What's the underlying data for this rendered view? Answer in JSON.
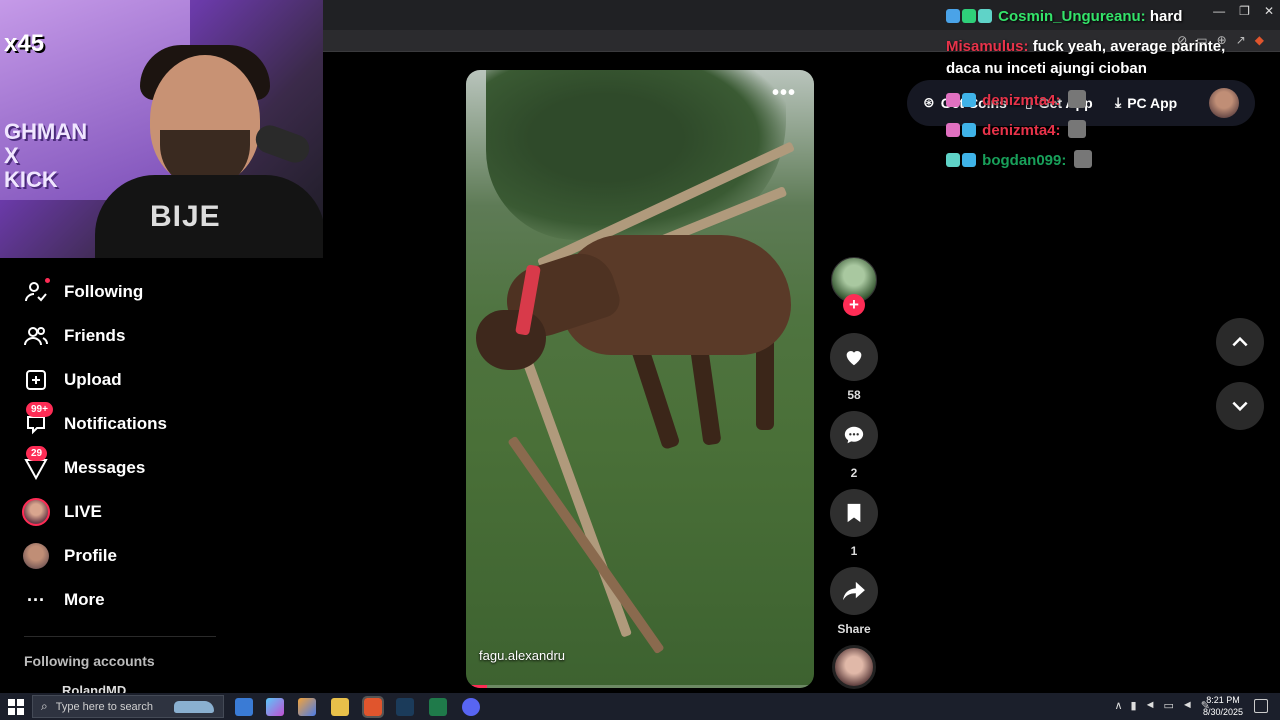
{
  "window": {
    "minimize": "—",
    "restore": "❐",
    "close": "✕"
  },
  "chat": [
    {
      "user": "Cosmin_Ungureanu:",
      "message": "hard",
      "user_color": "#34e36a"
    },
    {
      "user": "Misamulus:",
      "message": "fuck yeah, average parinte,",
      "user_color": "#e8334a"
    },
    {
      "user": "",
      "message": "daca nu inceti ajungi cioban",
      "user_color": "#ffffff"
    },
    {
      "user": "denizmta4:",
      "message": "",
      "user_color": "#e8334a"
    },
    {
      "user": "denizmta4:",
      "message": "",
      "user_color": "#e8334a"
    },
    {
      "user": "bogdan099:",
      "message": "",
      "user_color": "#18a05a"
    }
  ],
  "topbar": {
    "get_coins": "Get Coins",
    "get_app": "Get App",
    "pc_app": "PC App"
  },
  "sidebar": {
    "items": [
      {
        "label": "Following",
        "icon": "following-icon"
      },
      {
        "label": "Friends",
        "icon": "friends-icon"
      },
      {
        "label": "Upload",
        "icon": "upload-icon"
      },
      {
        "label": "Notifications",
        "icon": "notifications-icon",
        "badge": "99+"
      },
      {
        "label": "Messages",
        "icon": "messages-icon",
        "badge": "29"
      },
      {
        "label": "LIVE",
        "icon": "live-avatar"
      },
      {
        "label": "Profile",
        "icon": "profile-avatar"
      },
      {
        "label": "More",
        "icon": "more-icon"
      }
    ],
    "following_accounts_title": "Following accounts",
    "following_accounts": [
      "RolandMD"
    ]
  },
  "video": {
    "author": "fagu.alexandru",
    "more": "•••",
    "progress": 0.06
  },
  "actions": {
    "like_count": "58",
    "comment_count": "2",
    "save_count": "1",
    "share_label": "Share"
  },
  "webcam": {
    "overlay_badge": "x45",
    "poster_text": "GHMAN\nX\nKICK",
    "shirt_text": "BIJE"
  },
  "taskbar": {
    "search_placeholder": "Type here to search",
    "time": "8:21 PM",
    "date": "8/30/2025"
  }
}
